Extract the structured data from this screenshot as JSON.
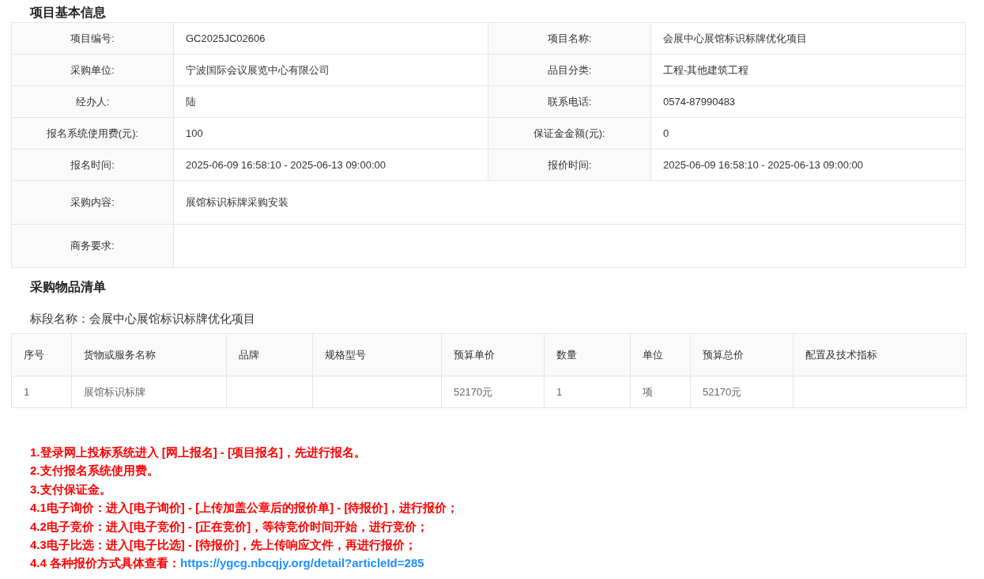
{
  "basic_info": {
    "title": "项目基本信息",
    "rows": [
      {
        "cells": [
          {
            "label": "项目编号:",
            "value": "GC2025JC02606"
          },
          {
            "label": "项目名称:",
            "value": "会展中心展馆标识标牌优化项目"
          }
        ]
      },
      {
        "cells": [
          {
            "label": "采购单位:",
            "value": "宁波国际会议展览中心有限公司"
          },
          {
            "label": "品目分类:",
            "value": "工程-其他建筑工程"
          }
        ]
      },
      {
        "cells": [
          {
            "label": "经办人:",
            "value": "陆"
          },
          {
            "label": "联系电话:",
            "value": "0574-87990483"
          }
        ]
      },
      {
        "cells": [
          {
            "label": "报名系统使用费(元):",
            "value": "100"
          },
          {
            "label": "保证金金额(元):",
            "value": "0"
          }
        ]
      },
      {
        "cells": [
          {
            "label": "报名时间:",
            "value": "2025-06-09 16:58:10 - 2025-06-13 09:00:00"
          },
          {
            "label": "报价时间:",
            "value": "2025-06-09 16:58:10 - 2025-06-13 09:00:00"
          }
        ]
      },
      {
        "cells": [
          {
            "label": "采购内容:",
            "value": "展馆标识标牌采购安装"
          }
        ]
      },
      {
        "cells": [
          {
            "label": "商务要求:"
          }
        ]
      }
    ]
  },
  "item_list": {
    "title": "采购物品清单",
    "lot_name": "标段名称：会展中心展馆标识标牌优化项目",
    "columns": [
      "序号",
      "货物或服务名称",
      "品牌",
      "规格型号",
      "预算单价",
      "数量",
      "单位",
      "预算总价",
      "配置及技术指标"
    ],
    "rows": [
      [
        "1",
        "展馆标识标牌",
        "",
        "",
        "52170元",
        "1",
        "项",
        "52170元",
        ""
      ]
    ]
  },
  "notes": [
    {
      "text": "1.登录网上投标系统进入 [网上报名] - [项目报名]，先进行报名。"
    },
    {
      "text": "2.支付报名系统使用费。"
    },
    {
      "text": "3.支付保证金。"
    },
    {
      "text": "4.1电子询价：进入[电子询价] - [上传加盖公章后的报价单] - [待报价]，进行报价；"
    },
    {
      "text": "4.2电子竞价：进入[电子竞价] - [正在竞价]，等待竞价时间开始，进行竞价；"
    },
    {
      "text": "4.3电子比选：进入[电子比选] - [待报价]，先上传响应文件，再进行报价；"
    },
    {
      "text": "4.4 各种报价方式具体查看：",
      "link": "https://ygcg.nbcqjy.org/detail?articleId=285"
    }
  ]
}
